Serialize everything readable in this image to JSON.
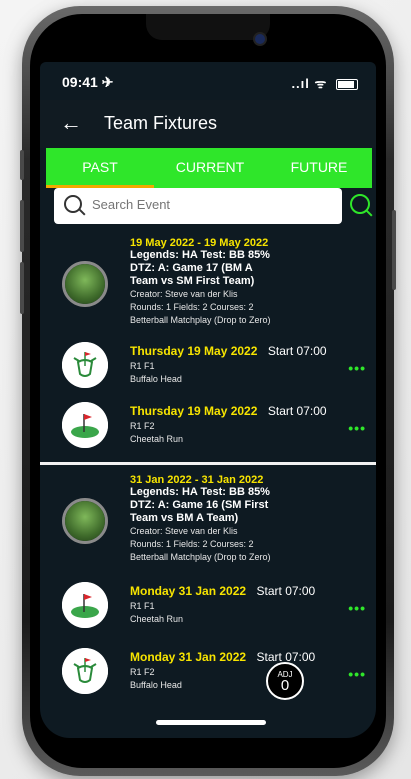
{
  "status": {
    "time": "09:41 ✈",
    "indicators": "..ıl ᯤ"
  },
  "header": {
    "title": "Team Fixtures",
    "back_icon": "←"
  },
  "tabs": [
    {
      "label": "PAST"
    },
    {
      "label": "CURRENT"
    },
    {
      "label": "FUTURE"
    }
  ],
  "search": {
    "placeholder": "Search Event"
  },
  "events": [
    {
      "date_range": "19 May 2022 - 19 May 2022",
      "name_lines": [
        "Legends: HA Test: BB 85%",
        "DTZ: A: Game 17 (BM A",
        "Team vs SM First Team)"
      ],
      "creator": "Creator: Steve van der Klis",
      "rounds": "Rounds: 1 Fields: 2 Courses: 2",
      "format": "Betterball Matchplay (Drop to Zero)",
      "fixtures": [
        {
          "date": "Thursday 19 May 2022",
          "start": "Start 07:00",
          "field": "R1 F1",
          "course": "Buffalo Head",
          "icon": "buffalo-golf-icon"
        },
        {
          "date": "Thursday 19 May 2022",
          "start": "Start 07:00",
          "field": "R1 F2",
          "course": "Cheetah Run",
          "icon": "golf-green-icon"
        }
      ]
    },
    {
      "date_range": "31 Jan 2022 - 31 Jan 2022",
      "name_lines": [
        "Legends: HA Test: BB 85%",
        "DTZ: A: Game 16 (SM First",
        "Team vs BM A Team)"
      ],
      "creator": "Creator: Steve van der Klis",
      "rounds": "Rounds: 1 Fields: 2 Courses: 2",
      "format": "Betterball Matchplay (Drop to Zero)",
      "fixtures": [
        {
          "date": "Monday 31 Jan 2022",
          "start": "Start 07:00",
          "field": "R1 F1",
          "course": "Cheetah Run",
          "icon": "golf-green-icon"
        },
        {
          "date": "Monday 31 Jan 2022",
          "start": "Start 07:00",
          "field": "R1 F2",
          "course": "Buffalo Head",
          "icon": "buffalo-golf-icon"
        }
      ]
    }
  ],
  "more_label": "•••",
  "adj": {
    "label": "ADJ",
    "count": "0"
  },
  "colors": {
    "accent": "#2fe62a",
    "highlight": "#f7e400",
    "tab_underline": "#f2a900",
    "background": "#0e1a22"
  }
}
